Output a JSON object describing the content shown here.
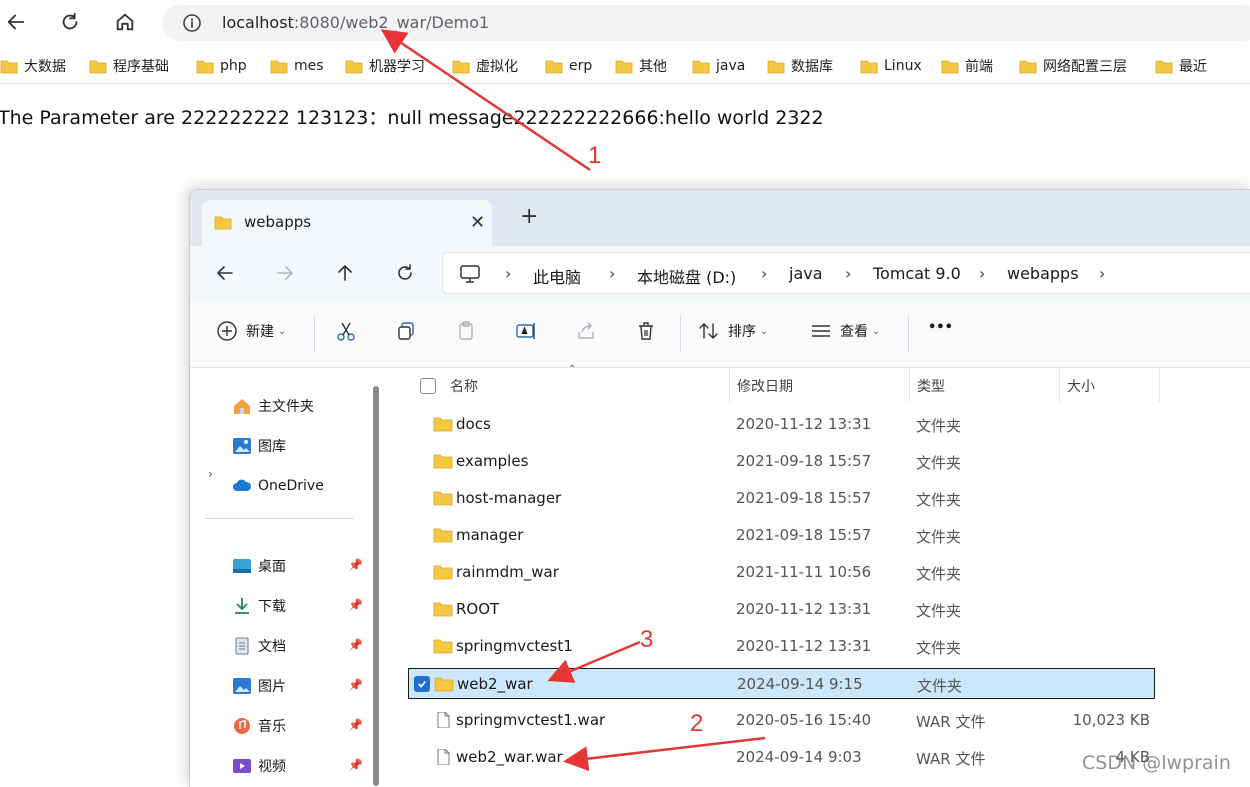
{
  "browser": {
    "url_host": "localhost",
    "url_rest": ":8080/web2_war/Demo1",
    "bookmarks": [
      "大数据",
      "程序基础",
      "php",
      "mes",
      "机器学习",
      "虚拟化",
      "erp",
      "其他",
      "java",
      "数据库",
      "Linux",
      "前端",
      "网络配置三层",
      "最近"
    ]
  },
  "page": {
    "text": "The Parameter are 222222222 123123：null message222222222666:hello world 2322"
  },
  "explorer": {
    "tab_label": "webapps",
    "tab_close": "✕",
    "new_tab": "+",
    "breadcrumb": [
      "此电脑",
      "本地磁盘 (D:)",
      "java",
      "Tomcat 9.0",
      "webapps"
    ],
    "breadcrumb_sep": "›",
    "commands": {
      "new": "新建",
      "sort": "排序",
      "view": "查看",
      "more": "•••"
    },
    "sidebar": {
      "top": [
        "主文件夹",
        "图库",
        "OneDrive"
      ],
      "pinned": [
        "桌面",
        "下载",
        "文档",
        "图片",
        "音乐",
        "视频"
      ]
    },
    "columns": {
      "name": "名称",
      "date": "修改日期",
      "type": "类型",
      "size": "大小"
    },
    "files": [
      {
        "name": "docs",
        "date": "2020-11-12 13:31",
        "type": "文件夹",
        "size": "",
        "kind": "folder"
      },
      {
        "name": "examples",
        "date": "2021-09-18 15:57",
        "type": "文件夹",
        "size": "",
        "kind": "folder"
      },
      {
        "name": "host-manager",
        "date": "2021-09-18 15:57",
        "type": "文件夹",
        "size": "",
        "kind": "folder"
      },
      {
        "name": "manager",
        "date": "2021-09-18 15:57",
        "type": "文件夹",
        "size": "",
        "kind": "folder"
      },
      {
        "name": "rainmdm_war",
        "date": "2021-11-11 10:56",
        "type": "文件夹",
        "size": "",
        "kind": "folder"
      },
      {
        "name": "ROOT",
        "date": "2020-11-12 13:31",
        "type": "文件夹",
        "size": "",
        "kind": "folder"
      },
      {
        "name": "springmvctest1",
        "date": "2020-11-12 13:31",
        "type": "文件夹",
        "size": "",
        "kind": "folder"
      },
      {
        "name": "web2_war",
        "date": "2024-09-14 9:15",
        "type": "文件夹",
        "size": "",
        "kind": "folder",
        "selected": true
      },
      {
        "name": "springmvctest1.war",
        "date": "2020-05-16 15:40",
        "type": "WAR 文件",
        "size": "10,023 KB",
        "kind": "file"
      },
      {
        "name": "web2_war.war",
        "date": "2024-09-14 9:03",
        "type": "WAR 文件",
        "size": "4 KB",
        "kind": "file"
      }
    ]
  },
  "annotations": [
    "1",
    "2",
    "3"
  ],
  "watermark": "CSDN @lwprain",
  "colors": {
    "folder": "#f4c842",
    "accent": "#1f6fd0",
    "selection": "#cce6fb",
    "annotation": "#e53535"
  }
}
